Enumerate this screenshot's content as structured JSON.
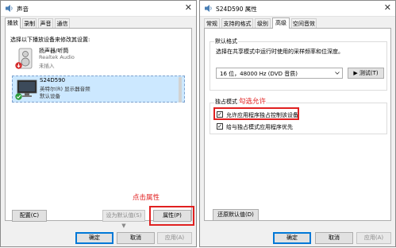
{
  "left_window": {
    "title": "声音",
    "close_glyph": "✕",
    "tabs": [
      "播放",
      "录制",
      "声音",
      "通信"
    ],
    "instruction": "选择以下播放设备来修改其设置:",
    "devices": [
      {
        "name": "扬声器/听筒",
        "line2": "Realtek Audio",
        "line3": "未插入",
        "icon": "speaker-icon",
        "status_icon": "unplugged-icon"
      },
      {
        "name": "S24D590",
        "line2": "英特尔(R) 显示器音频",
        "line3": "默认设备",
        "icon": "monitor-icon",
        "status_icon": "default-check-icon"
      }
    ],
    "annotation": "点击属性",
    "buttons": {
      "configure": "配置(C)",
      "set_default": "设为默认值(S) ▼",
      "properties": "属性(P)",
      "ok": "确定",
      "cancel": "取消",
      "apply": "应用(A)"
    }
  },
  "right_window": {
    "title": "S24D590 属性",
    "close_glyph": "✕",
    "tabs": [
      "常规",
      "支持的格式",
      "级别",
      "高级",
      "空间音效"
    ],
    "active_tab_index": 3,
    "default_format": {
      "group_label": "默认格式",
      "description": "选择在共享模式中运行时使用的采样频率和位深度。",
      "selected": "16 位，48000 Hz (DVD 音质)",
      "test_button": "▶ 测试(T)"
    },
    "exclusive": {
      "group_label": "独占模式",
      "annotation": "勾选允许",
      "options": [
        {
          "label": "允许应用程序独占控制该设备",
          "checked": true
        },
        {
          "label": "给与独占模式应用程序优先",
          "checked": true
        }
      ]
    },
    "buttons": {
      "restore": "还原默认值(D)",
      "ok": "确定",
      "cancel": "取消",
      "apply": "应用(A)"
    }
  },
  "colors": {
    "annotation_red": "#e02020",
    "selection_bg": "#cce8ff",
    "accent": "#0078d7"
  }
}
